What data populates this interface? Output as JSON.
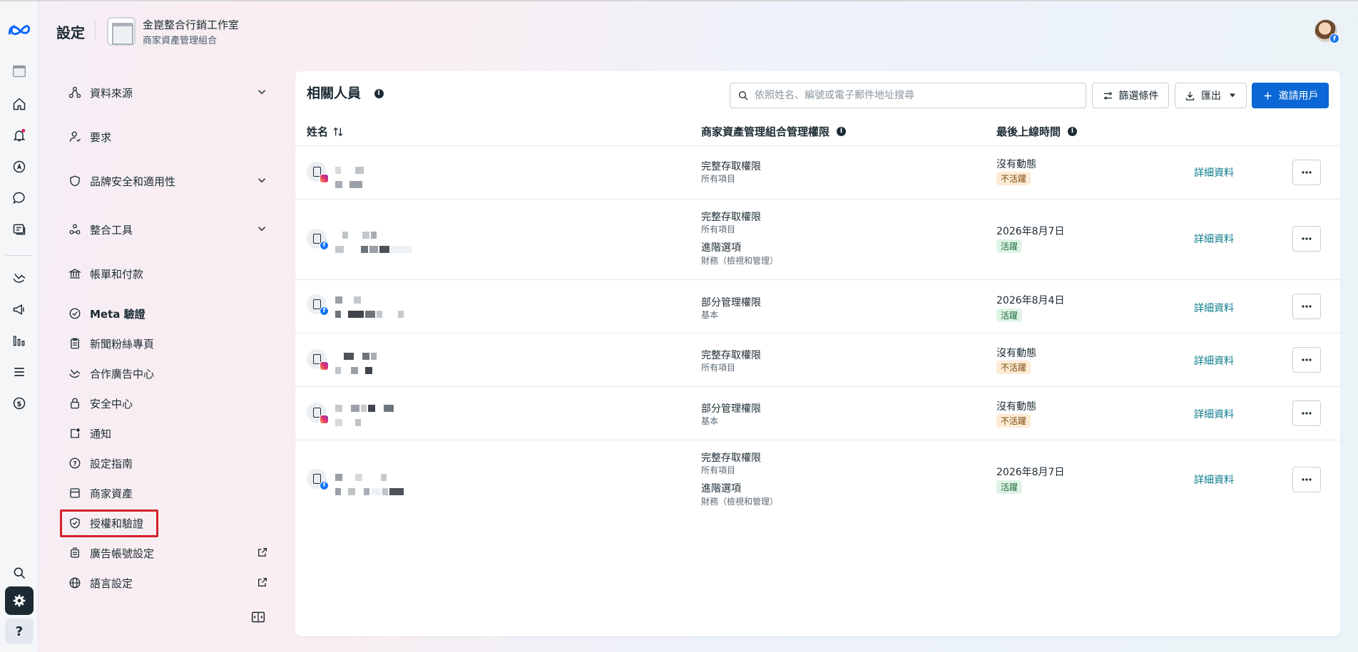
{
  "header": {
    "page_title": "設定",
    "business_name": "金崑整合行銷工作室",
    "business_subtitle": "商家資產管理組合"
  },
  "rail": {
    "icons": [
      "meta-logo-icon",
      "business-icon",
      "home-icon",
      "notifications-icon",
      "navigation-icon",
      "messages-icon",
      "content-icon",
      "partnerships-icon",
      "ads-icon",
      "insights-icon",
      "menu-icon",
      "billing-icon",
      "search-icon",
      "settings-icon",
      "help-icon"
    ],
    "help_label": "?"
  },
  "sidebar": {
    "items": [
      {
        "label": "資料來源"
      },
      {
        "label": "要求"
      },
      {
        "label": "品牌安全和適用性"
      },
      {
        "label": "整合工具"
      },
      {
        "label": "帳單和付款"
      },
      {
        "label": "Meta 驗證"
      },
      {
        "label": "新聞粉絲專頁"
      },
      {
        "label": "合作廣告中心"
      },
      {
        "label": "安全中心"
      },
      {
        "label": "通知"
      },
      {
        "label": "設定指南"
      },
      {
        "label": "商家資產"
      },
      {
        "label": "授權和驗證"
      },
      {
        "label": "廣告帳號設定"
      },
      {
        "label": "語言設定"
      }
    ]
  },
  "main": {
    "title": "相關人員",
    "search_placeholder": "依照姓名、編號或電子郵件地址搜尋",
    "filter_label": "篩選條件",
    "export_label": "匯出",
    "invite_label": "邀請用戶",
    "columns": {
      "name": "姓名",
      "permission": "商家資產管理組合管理權限",
      "last_online": "最後上線時間"
    },
    "rows": [
      {
        "platform": "instagram",
        "perm1": "完整存取權限",
        "perm1_sub": "所有項目",
        "perm2": "",
        "perm2_sub": "",
        "last": "沒有動態",
        "status": "不活躍",
        "status_type": "inactive",
        "details": "詳細資料"
      },
      {
        "platform": "facebook",
        "perm1": "完整存取權限",
        "perm1_sub": "所有項目",
        "perm2": "進階選項",
        "perm2_sub": "財務（檢視和管理）",
        "last": "2026年8月7日",
        "status": "活躍",
        "status_type": "active",
        "details": "詳細資料"
      },
      {
        "platform": "facebook",
        "perm1": "部分管理權限",
        "perm1_sub": "基本",
        "perm2": "",
        "perm2_sub": "",
        "last": "2026年8月4日",
        "status": "活躍",
        "status_type": "active",
        "details": "詳細資料"
      },
      {
        "platform": "instagram",
        "perm1": "完整存取權限",
        "perm1_sub": "所有項目",
        "perm2": "",
        "perm2_sub": "",
        "last": "沒有動態",
        "status": "不活躍",
        "status_type": "inactive",
        "details": "詳細資料"
      },
      {
        "platform": "instagram",
        "perm1": "部分管理權限",
        "perm1_sub": "基本",
        "perm2": "",
        "perm2_sub": "",
        "last": "沒有動態",
        "status": "不活躍",
        "status_type": "inactive",
        "details": "詳細資料"
      },
      {
        "platform": "facebook",
        "perm1": "完整存取權限",
        "perm1_sub": "所有項目",
        "perm2": "進階選項",
        "perm2_sub": "財務（檢視和管理）",
        "last": "2026年8月7日",
        "status": "活躍",
        "status_type": "active",
        "details": "詳細資料"
      }
    ]
  },
  "colors": {
    "accent_blue": "#0a67d5",
    "highlight_red": "#d4202a",
    "link_teal": "#0a7a8a"
  }
}
